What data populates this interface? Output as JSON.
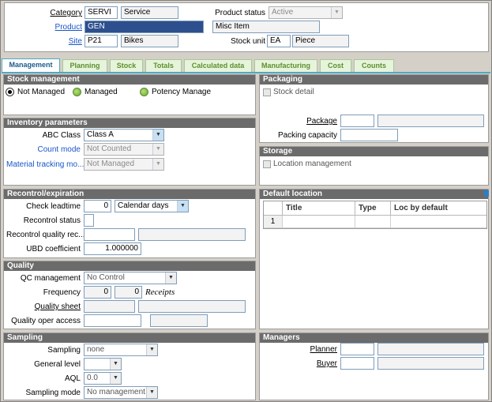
{
  "header": {
    "category": {
      "label": "Category",
      "code": "SERVI",
      "name": "Service"
    },
    "product": {
      "label": "Product",
      "code": "GEN",
      "name": "Misc Item"
    },
    "site": {
      "label": "Site",
      "code": "P21",
      "name": "Bikes"
    },
    "product_status": {
      "label": "Product status",
      "value": "Active"
    },
    "stock_unit": {
      "label": "Stock unit",
      "code": "EA",
      "name": "Piece"
    }
  },
  "tabs": [
    "Management",
    "Planning",
    "Stock",
    "Totals",
    "Calculated data",
    "Manufacturing",
    "Cost",
    "Counts"
  ],
  "stock_management": {
    "title": "Stock management",
    "options": [
      "Not Managed",
      "Managed",
      "Potency Manage"
    ],
    "selected": "Not Managed"
  },
  "inventory": {
    "title": "Inventory parameters",
    "abc_label": "ABC Class",
    "abc_value": "Class A",
    "count_mode_label": "Count mode",
    "count_mode_value": "Not Counted",
    "tracking_label": "Material tracking mo...",
    "tracking_value": "Not Managed"
  },
  "recontrol": {
    "title": "Recontrol/expiration",
    "leadtime_label": "Check leadtime",
    "leadtime_value": "0",
    "leadtime_unit": "Calendar days",
    "status_label": "Recontrol status",
    "quality_rec_label": "Recontrol quality rec...",
    "ubd_label": "UBD coefficient",
    "ubd_value": "1.000000"
  },
  "quality": {
    "title": "Quality",
    "qc_label": "QC management",
    "qc_value": "No Control",
    "freq_label": "Frequency",
    "freq_a": "0",
    "freq_b": "0",
    "freq_unit": "Receipts",
    "sheet_label": "Quality sheet",
    "oper_label": "Quality oper access"
  },
  "sampling": {
    "title": "Sampling",
    "sampling_label": "Sampling",
    "sampling_value": "none",
    "general_label": "General level",
    "aql_label": "AQL",
    "aql_value": "0.0",
    "mode_label": "Sampling mode",
    "mode_value": "No management"
  },
  "packaging": {
    "title": "Packaging",
    "stock_detail_label": "Stock detail",
    "package_label": "Package",
    "capacity_label": "Packing capacity"
  },
  "storage": {
    "title": "Storage",
    "location_mgmt_label": "Location management"
  },
  "default_location": {
    "title": "Default location",
    "columns": [
      "Title",
      "Type",
      "Loc by default"
    ],
    "rows": [
      {
        "num": "1",
        "title": "",
        "type": "",
        "loc": ""
      }
    ]
  },
  "managers": {
    "title": "Managers",
    "planner_label": "Planner",
    "buyer_label": "Buyer"
  }
}
